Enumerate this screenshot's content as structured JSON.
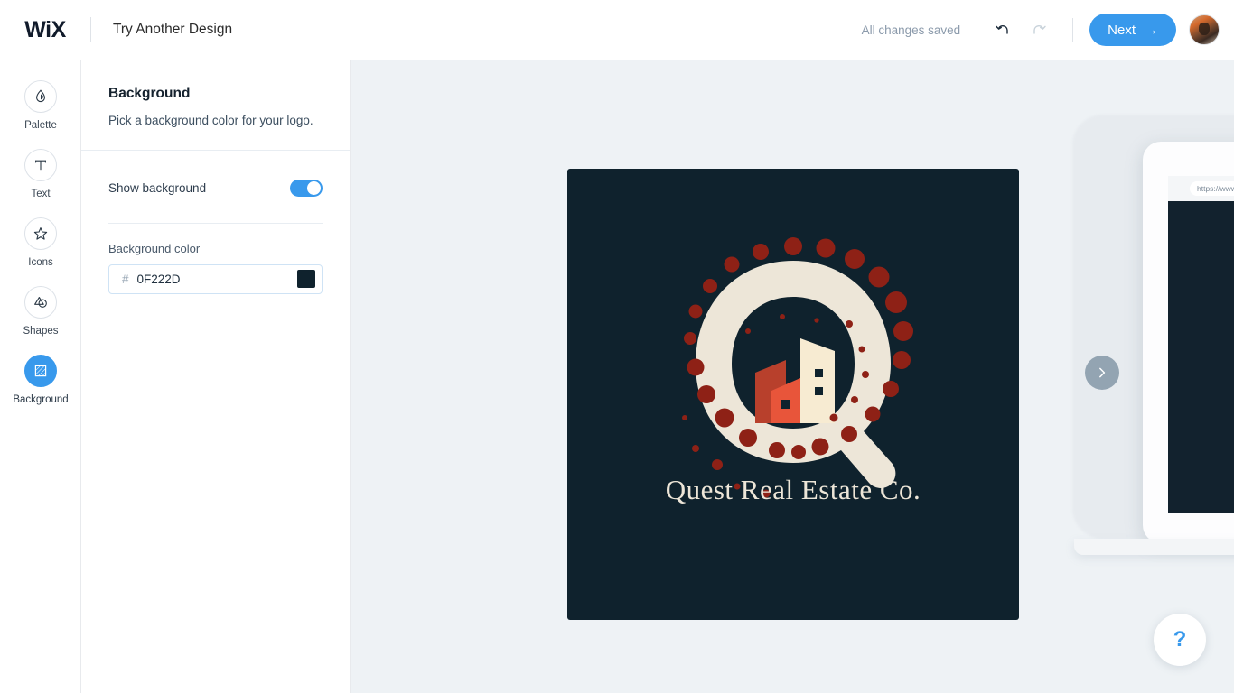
{
  "topbar": {
    "brand": "WiX",
    "design_title": "Try Another Design",
    "save_status": "All changes saved",
    "undo_icon": "undo-arrow-icon",
    "redo_icon": "redo-arrow-icon",
    "next_label": "Next",
    "next_arrow": "→",
    "accent_color": "#3899ec"
  },
  "sidebar": {
    "items": [
      {
        "label": "Palette",
        "icon": "droplet-icon",
        "active": false
      },
      {
        "label": "Text",
        "icon": "text-t-icon",
        "active": false
      },
      {
        "label": "Icons",
        "icon": "star-icon",
        "active": false
      },
      {
        "label": "Shapes",
        "icon": "shapes-icon",
        "active": false
      },
      {
        "label": "Background",
        "icon": "hatched-square-icon",
        "active": true
      }
    ]
  },
  "panel": {
    "title": "Background",
    "subtitle": "Pick a background color for your logo.",
    "toggle_label": "Show background",
    "toggle_on": true,
    "color_label": "Background color",
    "hash": "#",
    "color_value": "0F222D",
    "swatch_color": "#0F222D"
  },
  "logo": {
    "name": "Quest Real Estate Co.",
    "background_color": "#0F222D",
    "mark_color": "#EDE6D8",
    "dot_color": "#8E2116",
    "building_dark": "#B8402C",
    "building_light": "#E8553A",
    "building_cream": "#F7EBD2"
  },
  "stage": {
    "mockup_url": "https://www.m",
    "next_arrow_icon": "chevron-right-icon",
    "help_icon": "question-mark-icon",
    "help_label": "?"
  }
}
